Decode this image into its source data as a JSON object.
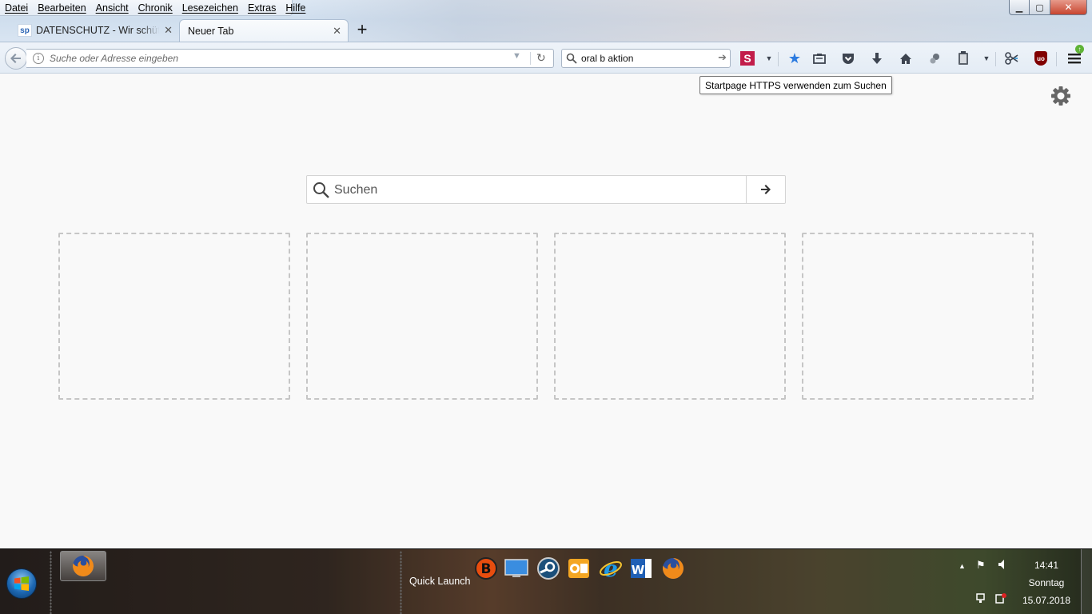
{
  "menubar": {
    "items": [
      "Datei",
      "Bearbeiten",
      "Ansicht",
      "Chronik",
      "Lesezeichen",
      "Extras",
      "Hilfe"
    ]
  },
  "window_controls": {
    "minimize": "▁",
    "maximize": "▢",
    "close": "✕"
  },
  "tabs": [
    {
      "title": "DATENSCHUTZ - Wir schützen",
      "favicon": "sp"
    },
    {
      "title": "Neuer Tab"
    }
  ],
  "tab_close": "✕",
  "new_tab": "+",
  "urlbar": {
    "placeholder": "Suche oder Adresse eingeben",
    "value": ""
  },
  "searchbar": {
    "value": "oral b aktion"
  },
  "toolbar": {
    "startpage_letter": "S",
    "ublock_label": "uo"
  },
  "tooltip": "Startpage HTTPS verwenden zum Suchen",
  "content_search": {
    "placeholder": "Suchen"
  },
  "taskbar": {
    "quick_launch": "Quick Launch",
    "clock": {
      "time": "14:41",
      "day": "Sonntag",
      "date": "15.07.2018"
    }
  },
  "colors": {
    "bookmark_star": "#2c7be0",
    "startpage": "#c21d4a",
    "ublock": "#800000",
    "update_badge": "#5fb336"
  }
}
